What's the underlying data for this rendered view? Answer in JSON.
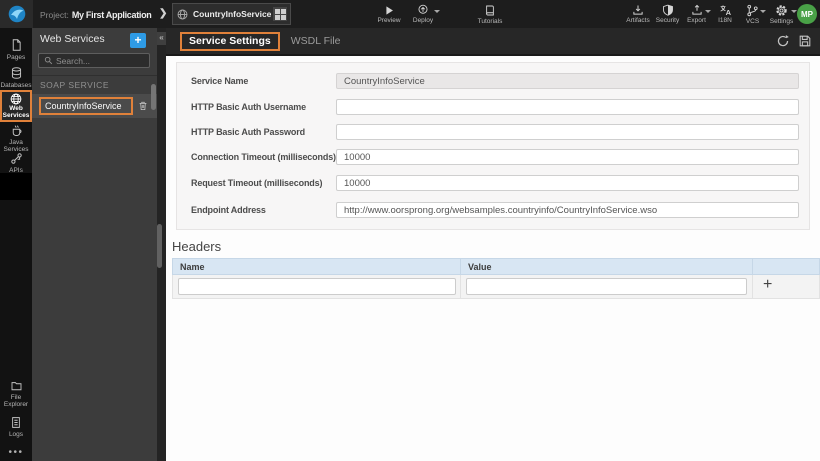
{
  "topbar": {
    "project_label": "Project:",
    "project_name": "My First Application",
    "breadcrumb_service": "CountryInfoService",
    "actions": [
      {
        "label": "Preview"
      },
      {
        "label": "Deploy"
      },
      {
        "label": "Tutorials"
      }
    ],
    "tools": [
      {
        "label": "Artifacts"
      },
      {
        "label": "Security"
      },
      {
        "label": "Export"
      },
      {
        "label": "I18N"
      },
      {
        "label": "VCS"
      },
      {
        "label": "Settings"
      }
    ],
    "avatar_initials": "MP"
  },
  "sidebar": {
    "items": [
      {
        "label": "Pages"
      },
      {
        "label": "Databases"
      },
      {
        "label": "Web Services",
        "active": true
      },
      {
        "label": "Java Services"
      },
      {
        "label": "APIs"
      }
    ],
    "bottom_items": [
      {
        "label": "File Explorer"
      },
      {
        "label": "Logs"
      }
    ],
    "overflow_label": "•••"
  },
  "panel": {
    "title": "Web Services",
    "add_button": "+",
    "collapse_button": "«",
    "search_placeholder": "Search...",
    "section_label": "SOAP SERVICE",
    "items": [
      {
        "label": "CountryInfoService"
      }
    ]
  },
  "tabs": [
    {
      "label": "Service Settings",
      "active": true
    },
    {
      "label": "WSDL File",
      "active": false
    }
  ],
  "form": {
    "fields": [
      {
        "label": "Service Name",
        "value": "CountryInfoService",
        "readonly": true
      },
      {
        "label": "HTTP Basic Auth Username",
        "value": ""
      },
      {
        "label": "HTTP Basic Auth Password",
        "value": ""
      },
      {
        "label": "Connection Timeout (milliseconds)",
        "value": "10000"
      },
      {
        "label": "Request Timeout (milliseconds)",
        "value": "10000"
      },
      {
        "label": "Endpoint Address",
        "value": "http://www.oorsprong.org/websamples.countryinfo/CountryInfoService.wso"
      }
    ]
  },
  "headers_section": {
    "title": "Headers",
    "columns": [
      "Name",
      "Value"
    ],
    "row": {
      "name": "",
      "value": ""
    },
    "add_button": "+"
  },
  "colors": {
    "accent_orange": "#e0813a",
    "accent_blue": "#2d9de0",
    "avatar_green": "#49a147",
    "table_header_blue": "#d8e6f3"
  }
}
